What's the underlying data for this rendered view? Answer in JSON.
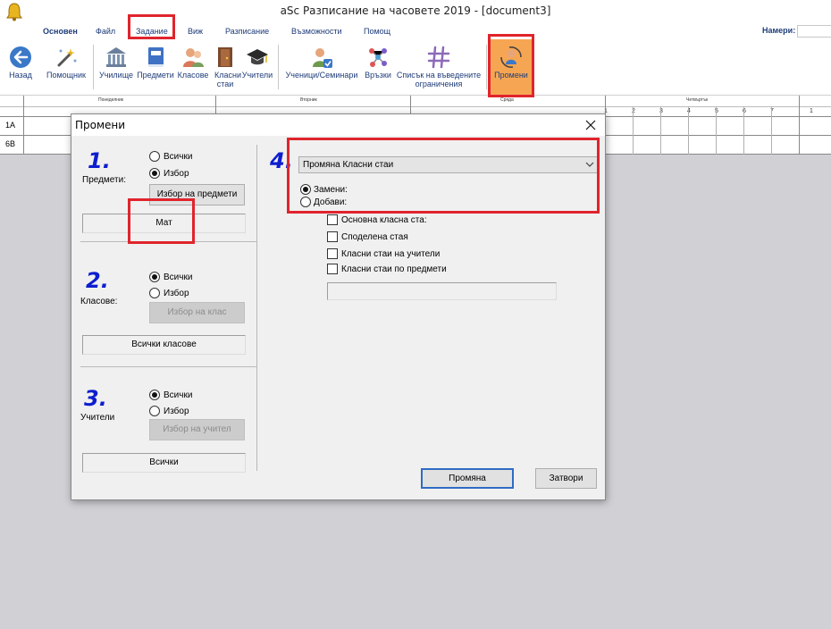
{
  "window": {
    "title": "aSc Разписание на часовете 2019  - [document3]"
  },
  "menu": {
    "items": [
      "Основен",
      "Файл",
      "Задание",
      "Виж",
      "Разписание",
      "Възможности",
      "Помощ"
    ],
    "find_label": "Намери:",
    "find_value": ""
  },
  "ribbon": {
    "back": "Назад",
    "wizard": "Помощник",
    "school": "Училище",
    "subjects": "Предмети",
    "classes": "Класове",
    "classrooms": "Класни стаи",
    "teachers": "Учители",
    "students": "Ученици/Семинари",
    "relations": "Връзки",
    "constraints": "Списък на въведените ограничения",
    "changes": "Промени"
  },
  "grid": {
    "rows": [
      "1A",
      "6B"
    ],
    "days": [
      "Понеделник",
      "Вторник",
      "Сряда",
      "Четвъртък"
    ],
    "periods": [
      "1",
      "2",
      "3",
      "4",
      "5",
      "6",
      "7"
    ],
    "last_period": "1"
  },
  "dialog": {
    "title": "Промени",
    "sections": [
      {
        "number": "1.",
        "caption": "Предмети:",
        "opt_all": "Всички",
        "opt_select": "Избор",
        "selected": "select",
        "button": "Избор на предмети",
        "button_enabled": true,
        "value": "Мат"
      },
      {
        "number": "2.",
        "caption": "Класове:",
        "opt_all": "Всички",
        "opt_select": "Избор",
        "selected": "all",
        "button": "Избор на клас",
        "button_enabled": false,
        "value": "Всички класове"
      },
      {
        "number": "3.",
        "caption": "Учители",
        "opt_all": "Всички",
        "opt_select": "Избор",
        "selected": "all",
        "button": "Избор на учител",
        "button_enabled": false,
        "value": "Всички"
      }
    ],
    "step4": {
      "number": "4.",
      "dropdown": "Промяна Класни стаи",
      "opt_replace": "Замени:",
      "opt_add": "Добави:",
      "checkboxes": [
        "Основна класна ста:",
        "Споделена стая",
        "Класни стаи на учители",
        "Класни стаи по предмети"
      ],
      "value": ""
    },
    "btn_apply": "Промяна",
    "btn_close": "Затвори"
  }
}
